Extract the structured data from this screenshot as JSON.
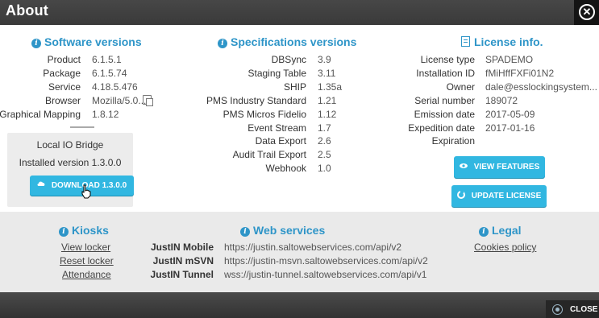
{
  "window": {
    "title": "About"
  },
  "software": {
    "title": "Software versions",
    "rows": [
      {
        "label": "Product",
        "value": "6.1.5.1"
      },
      {
        "label": "Package",
        "value": "6.1.5.74"
      },
      {
        "label": "Service",
        "value": "4.18.5.476"
      },
      {
        "label": "Browser",
        "value": "Mozilla/5.0..."
      },
      {
        "label": "Graphical Mapping",
        "value": "1.8.12"
      }
    ]
  },
  "bridge": {
    "title": "Local IO Bridge",
    "installed": "Installed version 1.3.0.0",
    "download_label": "DOWNLOAD 1.3.0.0"
  },
  "specs": {
    "title": "Specifications versions",
    "rows": [
      {
        "label": "DBSync",
        "value": "3.9"
      },
      {
        "label": "Staging Table",
        "value": "3.11"
      },
      {
        "label": "SHIP",
        "value": "1.35a"
      },
      {
        "label": "PMS Industry Standard",
        "value": "1.21"
      },
      {
        "label": "PMS Micros Fidelio",
        "value": "1.12"
      },
      {
        "label": "Event Stream",
        "value": "1.7"
      },
      {
        "label": "Data Export",
        "value": "2.6"
      },
      {
        "label": "Audit Trail Export",
        "value": "2.5"
      },
      {
        "label": "Webhook",
        "value": "1.0"
      }
    ]
  },
  "license": {
    "title": "License info.",
    "rows": [
      {
        "label": "License type",
        "value": "SPADEMO"
      },
      {
        "label": "Installation ID",
        "value": "fMiHffFXFi01N2"
      },
      {
        "label": "Owner",
        "value": "dale@esslockingsystem..."
      },
      {
        "label": "Serial number",
        "value": "189072"
      },
      {
        "label": "Emission date",
        "value": "2017-05-09"
      },
      {
        "label": "Expedition date",
        "value": "2017-01-16"
      },
      {
        "label": "Expiration",
        "value": ""
      }
    ],
    "view_features_label": "VIEW FEATURES",
    "update_license_label": "UPDATE LICENSE"
  },
  "kiosks": {
    "title": "Kiosks",
    "links": [
      "View locker",
      "Reset locker",
      "Attendance"
    ]
  },
  "web_services": {
    "title": "Web services",
    "rows": [
      {
        "label": "JustIN Mobile",
        "value": "https://justin.saltowebservices.com/api/v2"
      },
      {
        "label": "JustIN mSVN",
        "value": "https://justin-msvn.saltowebservices.com/api/v2"
      },
      {
        "label": "JustIN Tunnel",
        "value": "wss://justin-tunnel.saltowebservices.com/api/v1"
      }
    ]
  },
  "legal": {
    "title": "Legal",
    "links": [
      "Cookies policy"
    ]
  },
  "footer": {
    "close_label": "CLOSE"
  }
}
